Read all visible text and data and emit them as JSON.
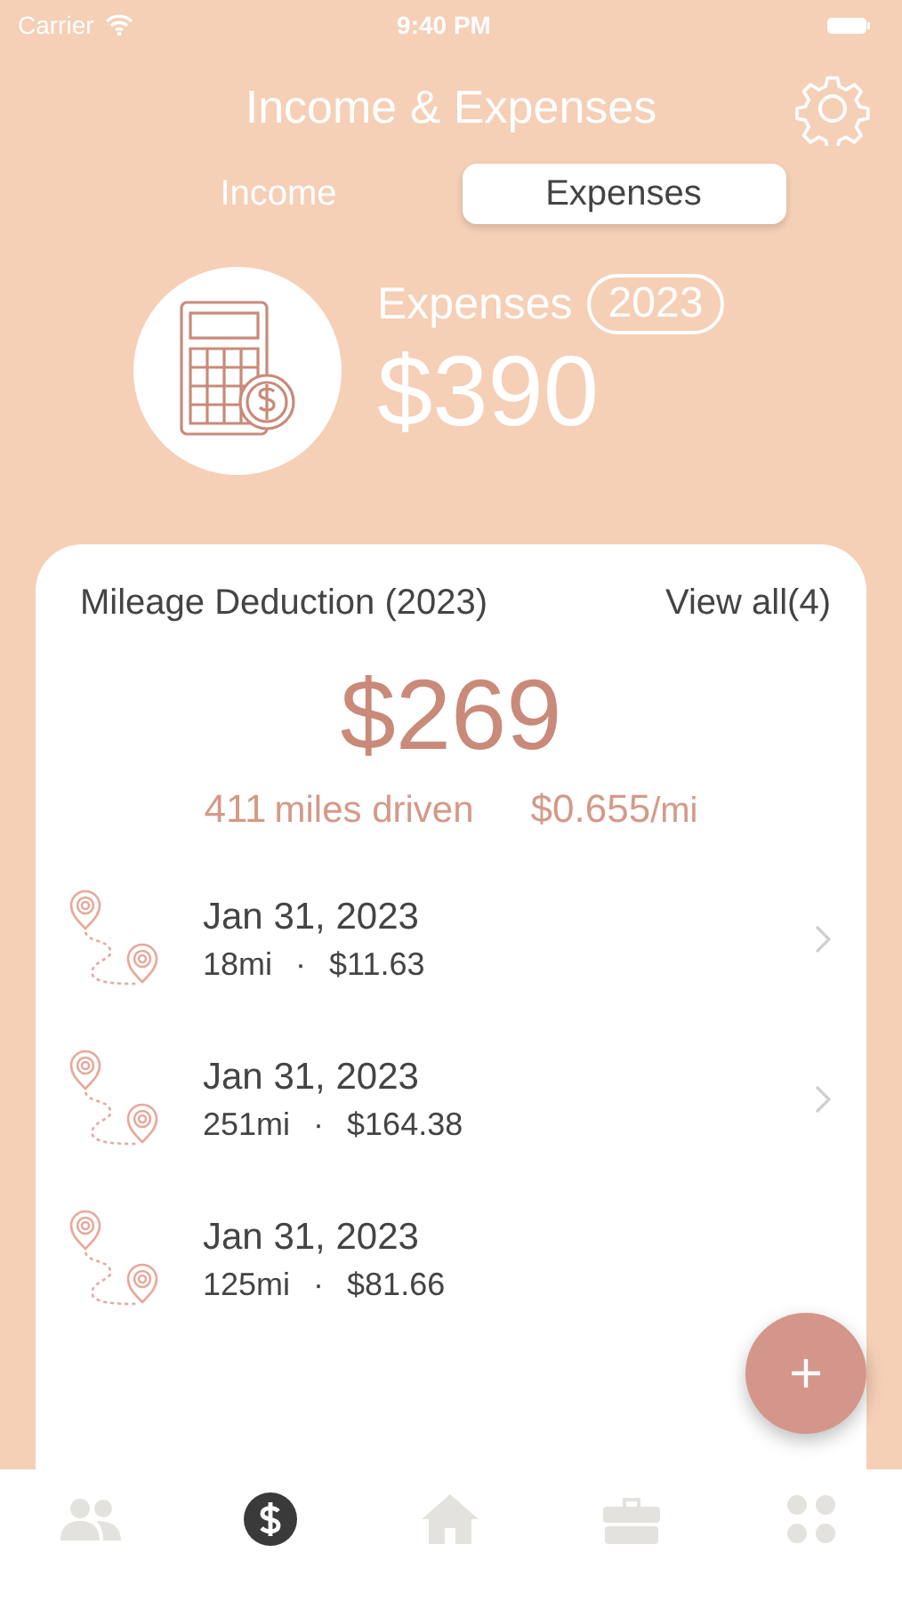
{
  "status_bar": {
    "carrier": "Carrier",
    "time": "9:40 PM"
  },
  "title": "Income & Expenses",
  "segments": [
    {
      "label": "Income",
      "selected": false
    },
    {
      "label": "Expenses",
      "selected": true
    }
  ],
  "summary": {
    "label": "Expenses",
    "year": "2023",
    "amount": "$390"
  },
  "mileage": {
    "title": "Mileage Deduction (2023)",
    "view_all": "View all(4)",
    "amount": "$269",
    "miles": "411",
    "miles_label": "miles driven",
    "rate": "$0.655",
    "rate_unit": "/mi",
    "trips": [
      {
        "date": "Jan 31, 2023",
        "distance": "18mi",
        "separator": "·",
        "amount": "$11.63"
      },
      {
        "date": "Jan 31, 2023",
        "distance": "251mi",
        "separator": "·",
        "amount": "$164.38"
      },
      {
        "date": "Jan 31, 2023",
        "distance": "125mi",
        "separator": "·",
        "amount": "$81.66"
      }
    ]
  },
  "tab_bar": [
    {
      "kind": "people",
      "selected": false
    },
    {
      "kind": "dollar",
      "selected": true
    },
    {
      "kind": "home",
      "selected": false
    },
    {
      "kind": "briefcase",
      "selected": false
    },
    {
      "kind": "grid",
      "selected": false
    }
  ]
}
